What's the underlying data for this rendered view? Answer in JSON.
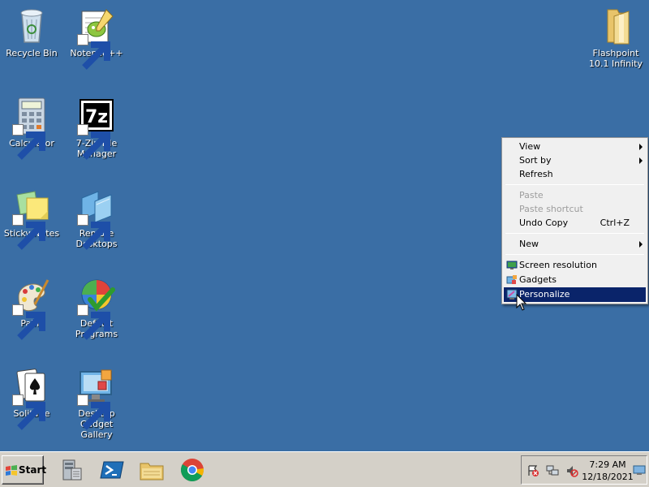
{
  "desktop": {
    "icons": [
      {
        "label": "Recycle Bin",
        "icon": "recycle-bin-icon"
      },
      {
        "label": "Notepad++",
        "icon": "notepad-plus-plus-icon"
      },
      {
        "label": "Flashpoint 10.1 Infinity",
        "icon": "folder-icon"
      },
      {
        "label": "Calculator",
        "icon": "calculator-icon"
      },
      {
        "label": "7-Zip File Manager",
        "icon": "seven-zip-icon"
      },
      {
        "label": "Sticky Notes",
        "icon": "sticky-notes-icon"
      },
      {
        "label": "Remote Desktops",
        "icon": "remote-desktops-icon"
      },
      {
        "label": "Paint",
        "icon": "paint-icon"
      },
      {
        "label": "Default Programs",
        "icon": "default-programs-icon"
      },
      {
        "label": "Solitaire",
        "icon": "solitaire-icon"
      },
      {
        "label": "Desktop Gadget Gallery",
        "icon": "gadget-gallery-icon"
      }
    ],
    "background_color": "#3a6ea5"
  },
  "context_menu": {
    "items": [
      {
        "label": "View",
        "submenu": true
      },
      {
        "label": "Sort by",
        "submenu": true
      },
      {
        "label": "Refresh"
      },
      {
        "label": "Paste",
        "disabled": true
      },
      {
        "label": "Paste shortcut",
        "disabled": true
      },
      {
        "label": "Undo Copy",
        "shortcut": "Ctrl+Z"
      },
      {
        "label": "New",
        "submenu": true
      },
      {
        "label": "Screen resolution",
        "icon": "screen-resolution-icon"
      },
      {
        "label": "Gadgets",
        "icon": "gadgets-icon"
      },
      {
        "label": "Personalize",
        "icon": "personalize-icon",
        "selected": true
      }
    ],
    "selected_color": "#0a246a"
  },
  "taskbar": {
    "start_label": "Start",
    "pinned": [
      "server-manager-icon",
      "powershell-icon",
      "file-explorer-icon",
      "chrome-icon"
    ],
    "tray_icons": [
      "action-center-icon",
      "network-icon",
      "volume-muted-icon",
      "show-desktop-icon"
    ],
    "clock": {
      "time": "7:29 AM",
      "date": "12/18/2021"
    }
  }
}
